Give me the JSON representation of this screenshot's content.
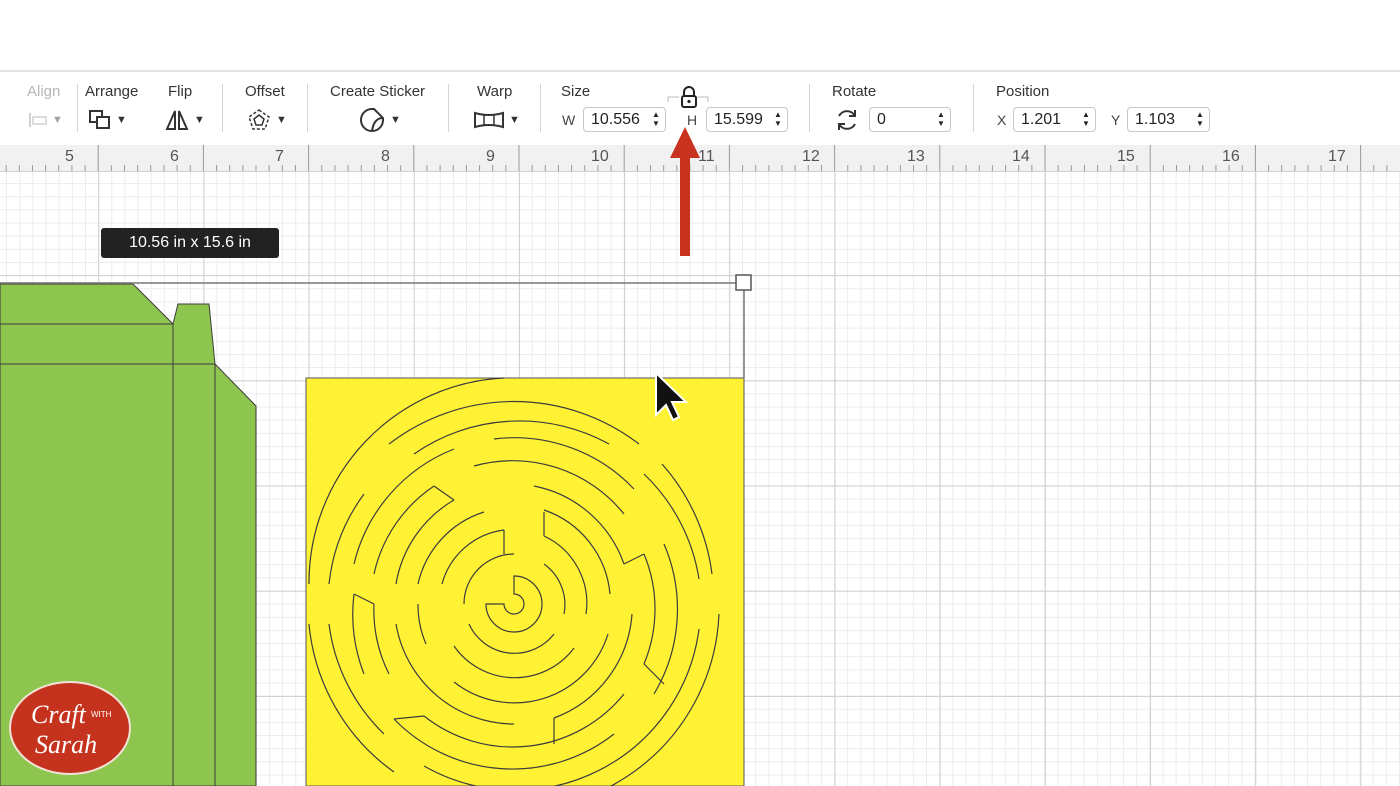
{
  "toolbar": {
    "align": {
      "label": "Align"
    },
    "arrange": {
      "label": "Arrange"
    },
    "flip": {
      "label": "Flip"
    },
    "offset": {
      "label": "Offset"
    },
    "create_sticker": {
      "label": "Create Sticker"
    },
    "warp": {
      "label": "Warp"
    },
    "size": {
      "label": "Size",
      "w_label": "W",
      "w_value": "10.556",
      "h_label": "H",
      "h_value": "15.599"
    },
    "rotate": {
      "label": "Rotate",
      "value": "0"
    },
    "position": {
      "label": "Position",
      "x_label": "X",
      "x_value": "1.201",
      "y_label": "Y",
      "y_value": "1.103"
    }
  },
  "ruler": {
    "marks": [
      "5",
      "6",
      "7",
      "8",
      "9",
      "10",
      "11",
      "12",
      "13",
      "14",
      "15",
      "16",
      "17"
    ]
  },
  "canvas": {
    "dimension_tooltip": "10.56  in x 15.6  in"
  },
  "colors": {
    "green": "#8dc54f",
    "yellow": "#fff234",
    "arrow_red": "#c8321f",
    "logo_red": "#c5331f"
  },
  "logo": {
    "line1": "Craft",
    "small": "WITH",
    "line2": "Sarah"
  }
}
